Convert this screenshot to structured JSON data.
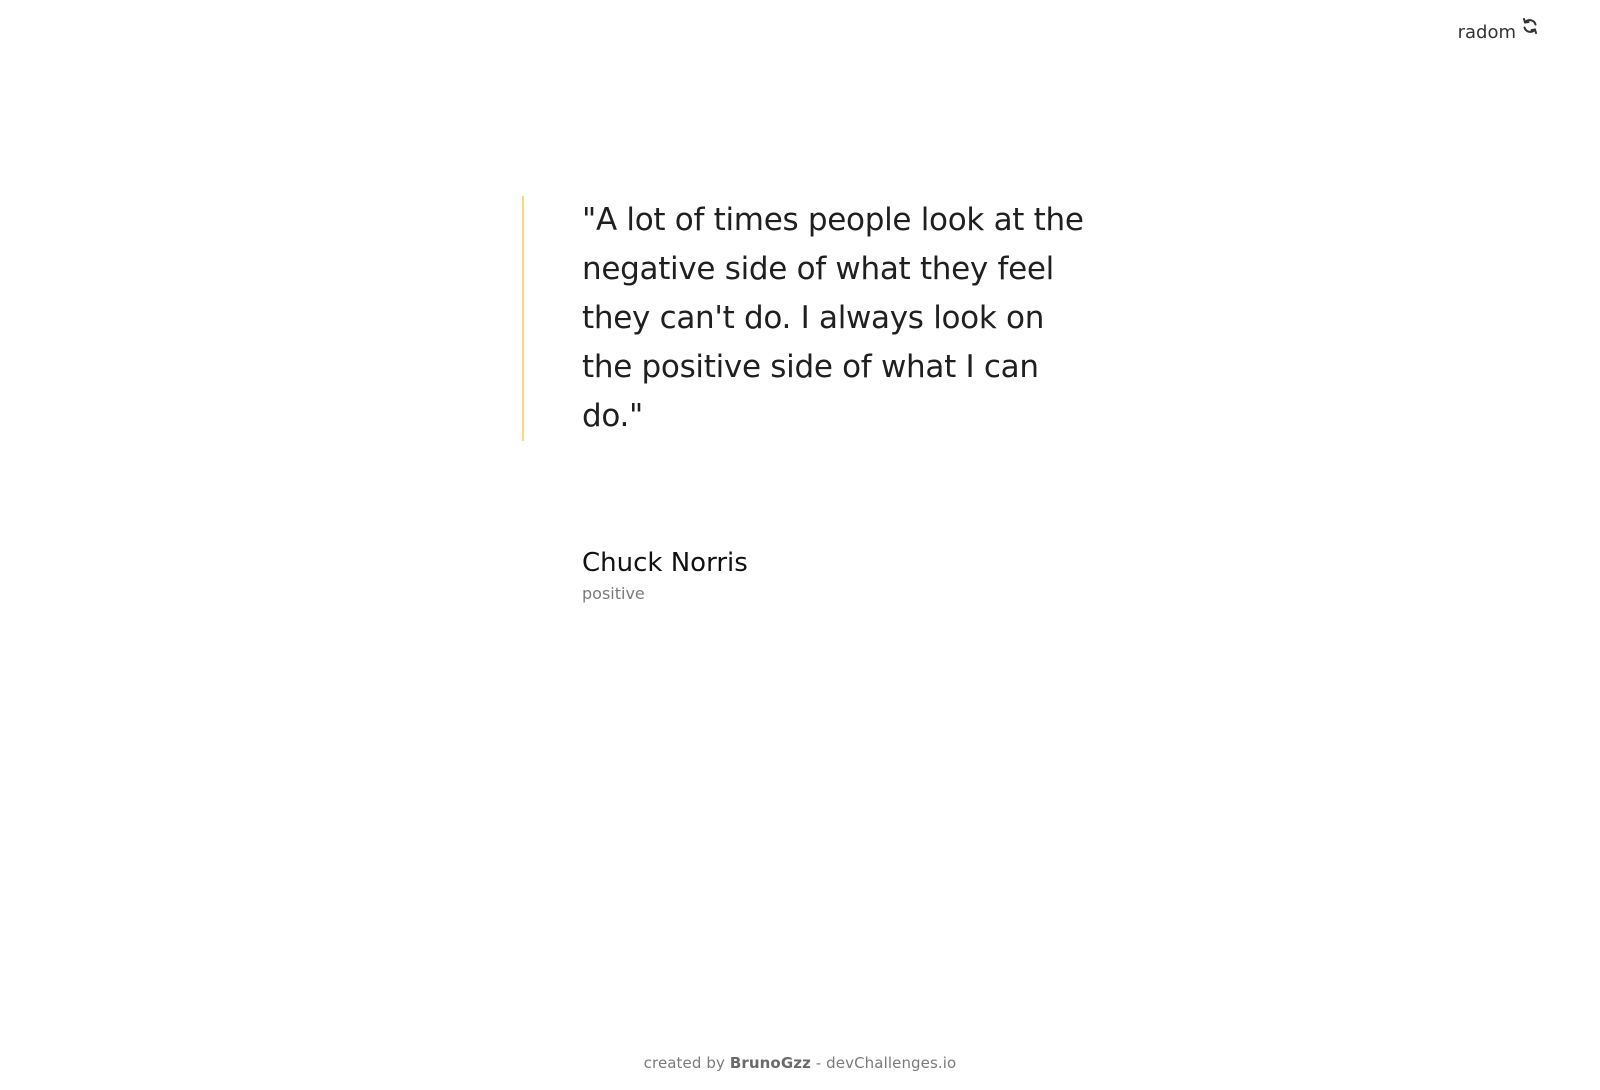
{
  "header": {
    "random_label": "radom",
    "random_icon": "refresh-icon"
  },
  "quote": {
    "text": "\"A lot of times people look at the negative side of what they feel they can't do. I always look on the positive side of what I can do.\"",
    "accent_color": "#f7d87a"
  },
  "author": {
    "name": "Chuck Norris",
    "genre": "positive"
  },
  "footer": {
    "prefix": "created by",
    "author": "BrunoGzz",
    "separator_suffix": "- devChallenges.io"
  }
}
